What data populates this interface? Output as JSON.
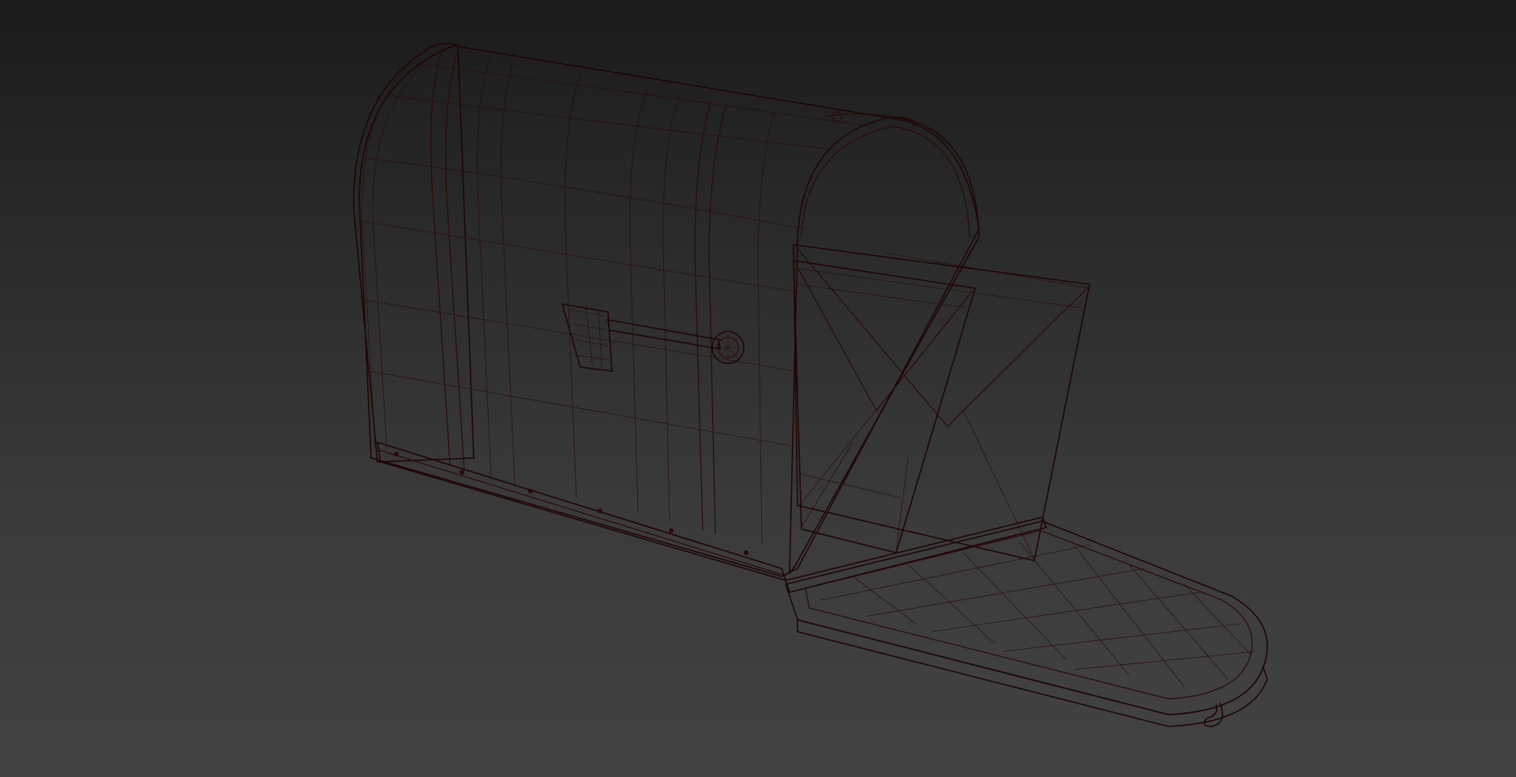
{
  "viewport": {
    "background_top": "#1b1b1b",
    "background_bottom": "#434343"
  },
  "model": {
    "name_icon": "mailbox-wireframe",
    "base_color": "#a63a2e",
    "shadow_color": "#7a1f18",
    "highlight_color": "#c2503f",
    "wire_color": "#2a0a08",
    "door_state": "open",
    "flag_state": "down",
    "contents": "envelopes"
  }
}
